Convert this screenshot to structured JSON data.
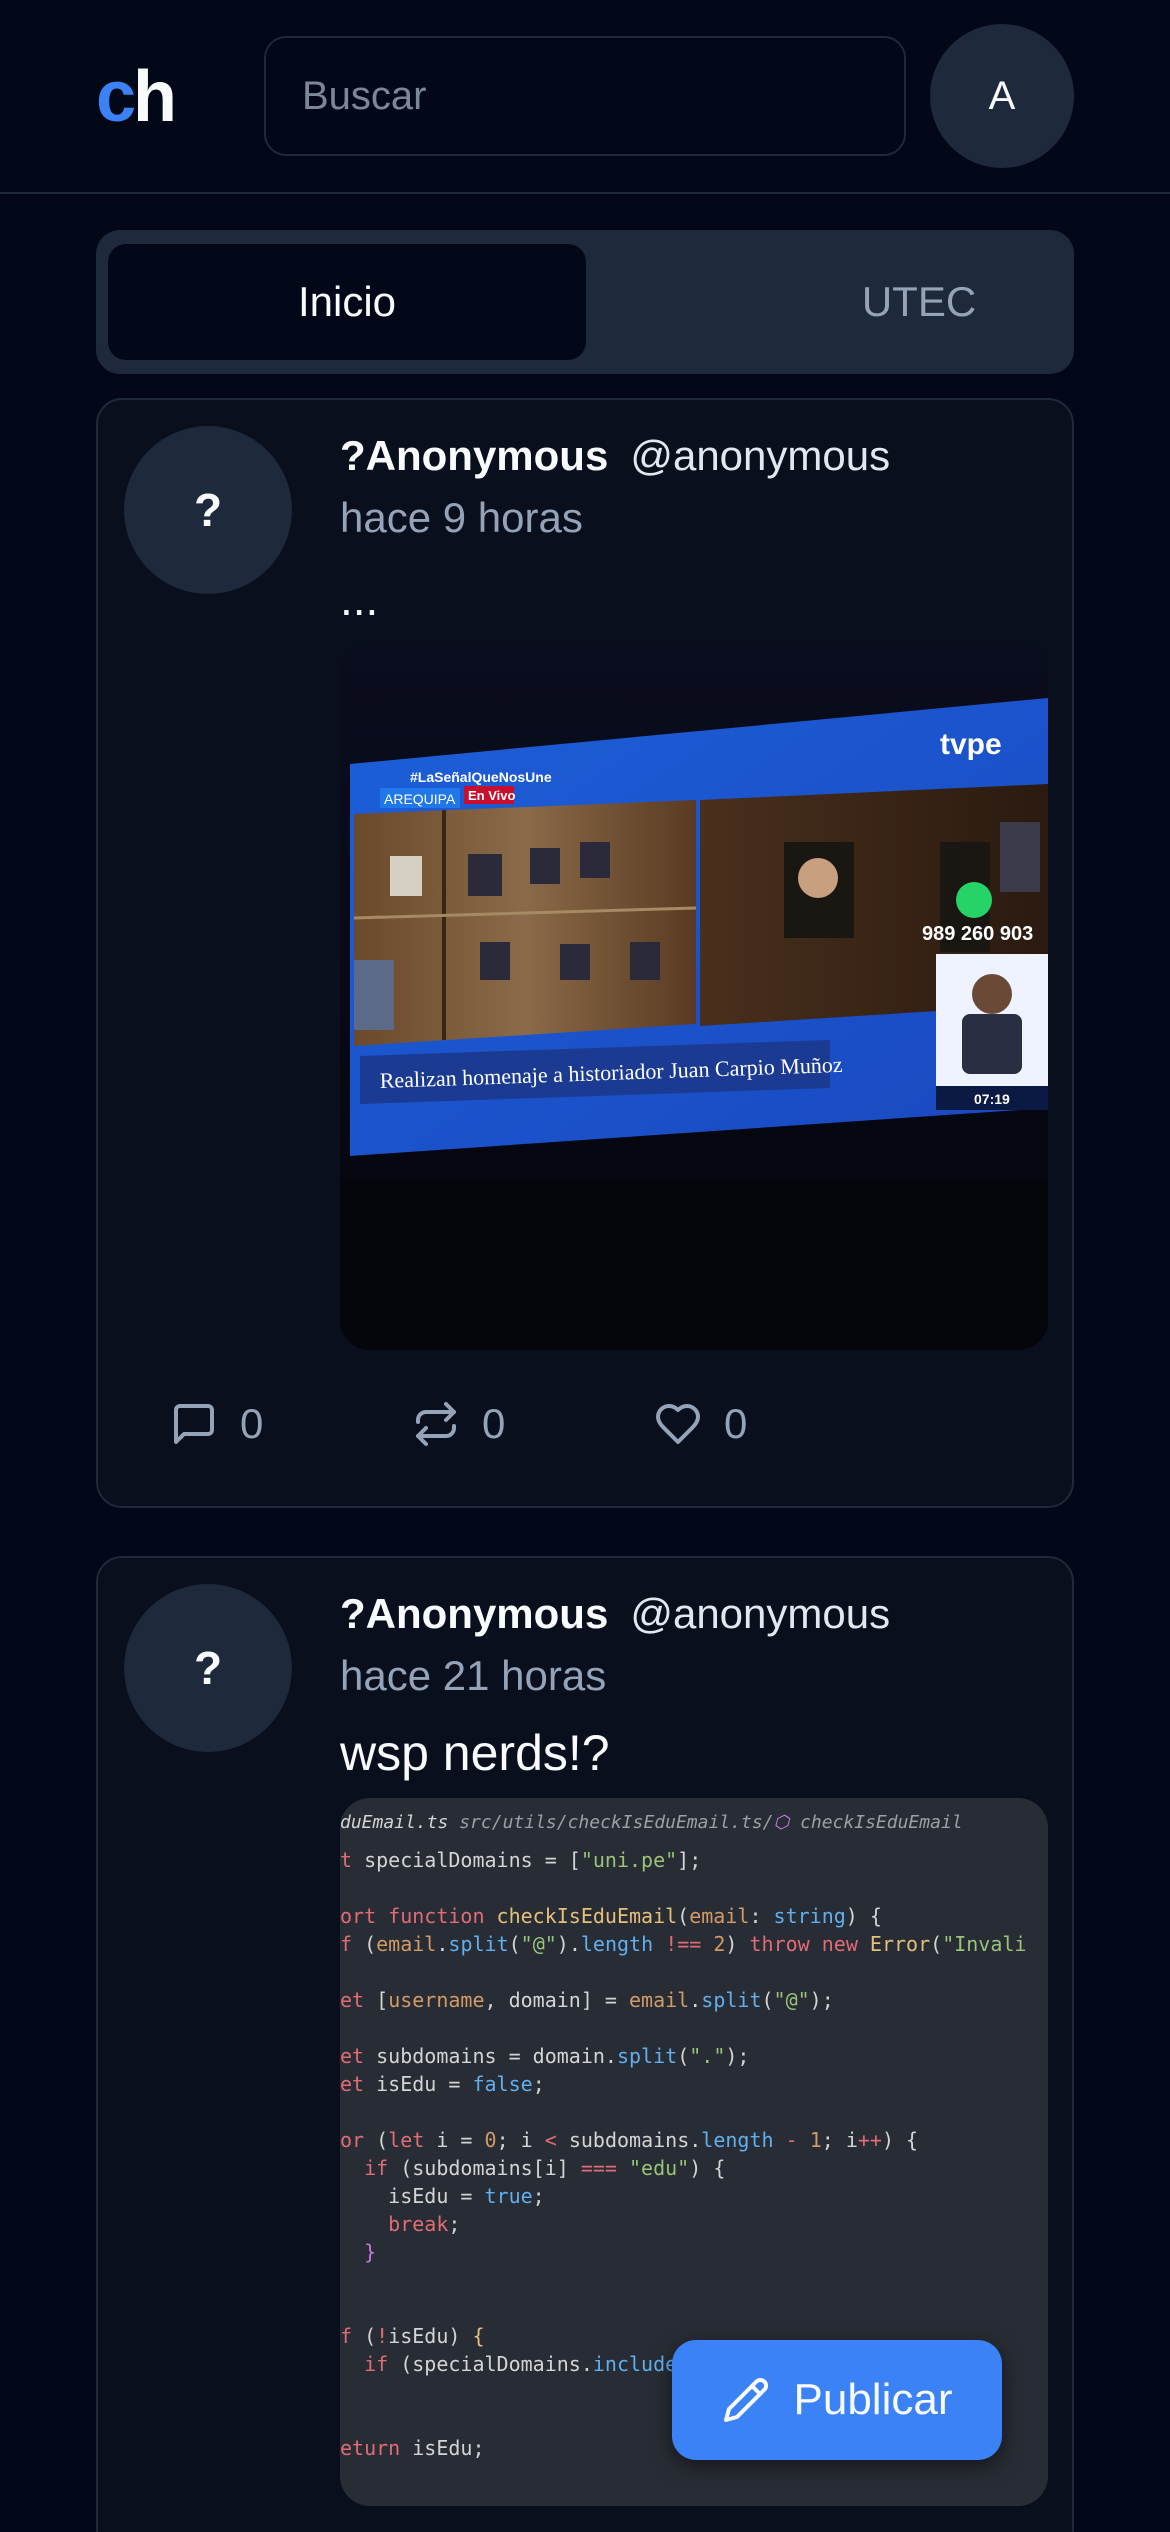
{
  "header": {
    "logo_c": "c",
    "logo_h": "h",
    "search_placeholder": "Buscar",
    "avatar_initial": "A"
  },
  "tabs": [
    {
      "label": "Inicio",
      "active": true
    },
    {
      "label": "UTEC",
      "active": false
    }
  ],
  "posts": [
    {
      "avatar": "?",
      "name": "?Anonymous",
      "handle": "@anonymous",
      "time": "hace 9 horas",
      "text": "...",
      "media": {
        "hashtag": "#LaSeñalQueNosUne",
        "location": "AREQUIPA",
        "live_badge": "En Vivo",
        "channel": "tvpe",
        "phone": "989 260 903",
        "headline": "Realizan homenaje a historiador Juan Carpio Muñoz",
        "clock": "07:19"
      },
      "comments": "0",
      "reposts": "0",
      "likes": "0"
    },
    {
      "avatar": "?",
      "name": "?Anonymous",
      "handle": "@anonymous",
      "time": "hace 21 horas",
      "text": "wsp nerds!?",
      "media": {
        "filename": "duEmail.ts",
        "path": "src/utils/checkIsEduEmail.ts/",
        "symbol": "checkIsEduEmail"
      }
    }
  ],
  "fab": {
    "label": "Publicar"
  },
  "colors": {
    "accent": "#3b82f6",
    "background": "#020817",
    "card": "#090f1d",
    "border": "#1e293b"
  },
  "icons": [
    "comment-icon",
    "repost-icon",
    "heart-icon",
    "pencil-icon"
  ]
}
